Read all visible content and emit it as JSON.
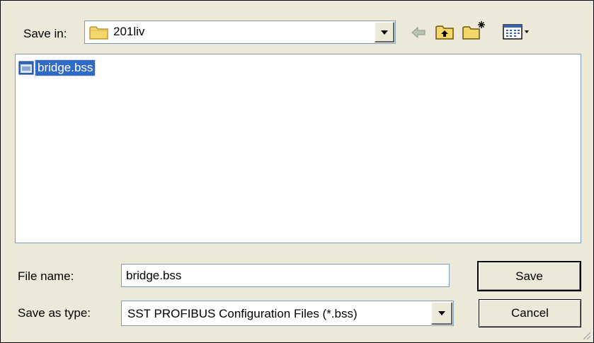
{
  "save_in": {
    "label": "Save in:",
    "folder": "201liv"
  },
  "toolbar": {
    "back_icon": "back-arrow-icon",
    "up_icon": "up-folder-icon",
    "new_folder_icon": "new-folder-icon",
    "view_menu_icon": "view-menu-icon"
  },
  "files": [
    {
      "name": "bridge.bss",
      "selected": true,
      "icon": "bss-file-icon"
    }
  ],
  "file_name": {
    "label": "File name:",
    "value": "bridge.bss"
  },
  "save_as_type": {
    "label": "Save as type:",
    "value": "SST PROFIBUS Configuration Files (*.bss)"
  },
  "buttons": {
    "save": "Save",
    "cancel": "Cancel"
  },
  "colors": {
    "selection": "#316ac5",
    "dialog_bg": "#ece9d8",
    "field_border": "#7f9db9"
  }
}
